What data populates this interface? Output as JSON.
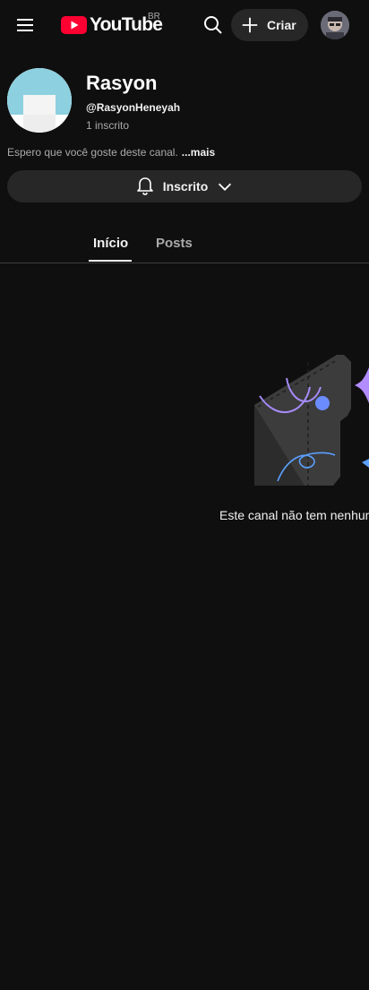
{
  "header": {
    "logo_text": "YouTube",
    "country_code": "BR",
    "create_label": "Criar"
  },
  "channel": {
    "name": "Rasyon",
    "handle": "@RasyonHeneyah",
    "subscribers": "1 inscrito",
    "description": "Espero que você goste deste canal.",
    "more_label": "...mais"
  },
  "subscribe_button": {
    "label": "Inscrito"
  },
  "tabs": [
    {
      "label": "Início",
      "selected": true
    },
    {
      "label": "Posts",
      "selected": false
    }
  ],
  "empty_state": {
    "message": "Este canal não tem nenhum"
  },
  "colors": {
    "background": "#0f0f0f",
    "youtube_red": "#ff0033",
    "surface": "#272727"
  },
  "icons": [
    "menu-icon",
    "youtube-logo-icon",
    "search-icon",
    "plus-icon",
    "bell-icon",
    "chevron-down-icon"
  ]
}
